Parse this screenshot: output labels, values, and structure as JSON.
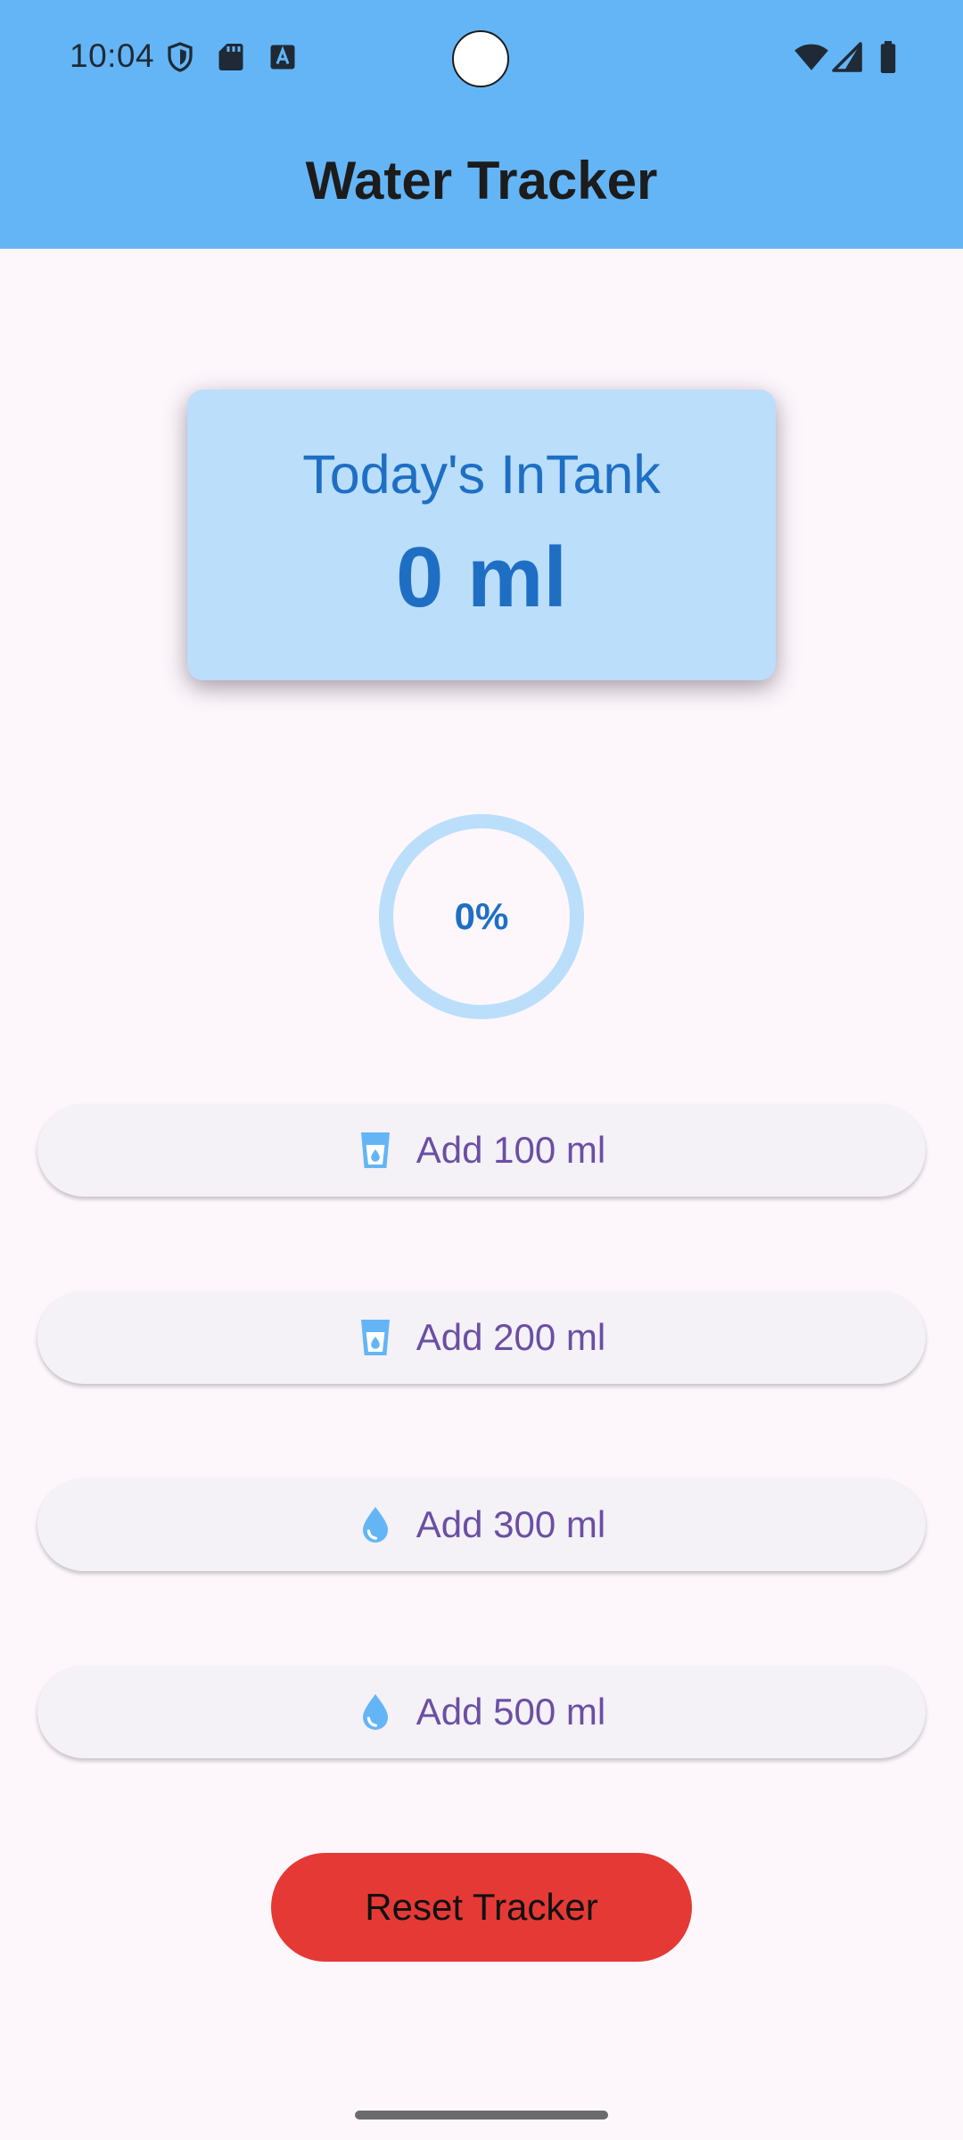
{
  "status_bar": {
    "time": "10:04",
    "icons": [
      "shield-icon",
      "sd-card-icon",
      "text-a-icon",
      "wifi-icon",
      "cell-signal-icon",
      "battery-icon"
    ]
  },
  "app_bar": {
    "title": "Water Tracker",
    "background_color": "#64b5f6"
  },
  "total_card": {
    "label": "Today's InTank",
    "value": "0 ml",
    "background_color": "#bbdefb",
    "text_color": "#1e6fc4"
  },
  "progress": {
    "percent_text": "0%",
    "fraction": 0,
    "track_color": "#bbdefb",
    "fill_color": "#1e88e5"
  },
  "add_buttons": [
    {
      "label": "Add 100 ml",
      "icon": "glass-water-icon"
    },
    {
      "label": "Add 200 ml",
      "icon": "glass-water-icon"
    },
    {
      "label": "Add 300 ml",
      "icon": "water-drop-icon"
    },
    {
      "label": "Add 500 ml",
      "icon": "water-drop-icon"
    }
  ],
  "reset_button": {
    "label": "Reset Tracker",
    "color": "#e53935"
  },
  "colors": {
    "page_background": "#fdf7fc",
    "button_label": "#6a4fa3",
    "icon_blue": "#64b5f6"
  }
}
